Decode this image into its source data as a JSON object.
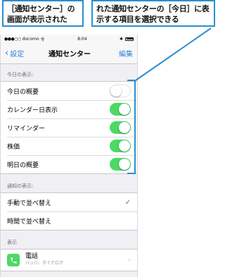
{
  "callouts": {
    "left": "［通知センター］の画面が表示された",
    "right": "れた通知センターの［今日］に表示する項目を選択できる"
  },
  "statusbar": {
    "signal": "●●●○○",
    "carrier": "docomo",
    "wifi": "令",
    "time": "8:04",
    "bluetooth": "✱"
  },
  "navbar": {
    "back_label": "設定",
    "title": "通知センター",
    "edit_label": "編集"
  },
  "today_section": {
    "header": "今日の表示:",
    "items": [
      {
        "label": "今日の概要",
        "enabled": false
      },
      {
        "label": "カレンダー日表示",
        "enabled": true
      },
      {
        "label": "リマインダー",
        "enabled": true
      },
      {
        "label": "株価",
        "enabled": true
      },
      {
        "label": "明日の概要",
        "enabled": true
      }
    ]
  },
  "notification_section": {
    "header": "通知の表示:",
    "items": [
      {
        "label": "手動で並べ替え",
        "checked": true
      },
      {
        "label": "時間で並べ替え",
        "checked": false
      }
    ]
  },
  "display_section": {
    "header": "表示",
    "apps": [
      {
        "name": "電話",
        "subtitle": "バッジ、ダイアログ",
        "icon": "phone-icon"
      }
    ]
  },
  "colors": {
    "accent": "#2f7fd9",
    "toggle_on": "#4cd964",
    "callout_border": "#2a8fd0"
  }
}
